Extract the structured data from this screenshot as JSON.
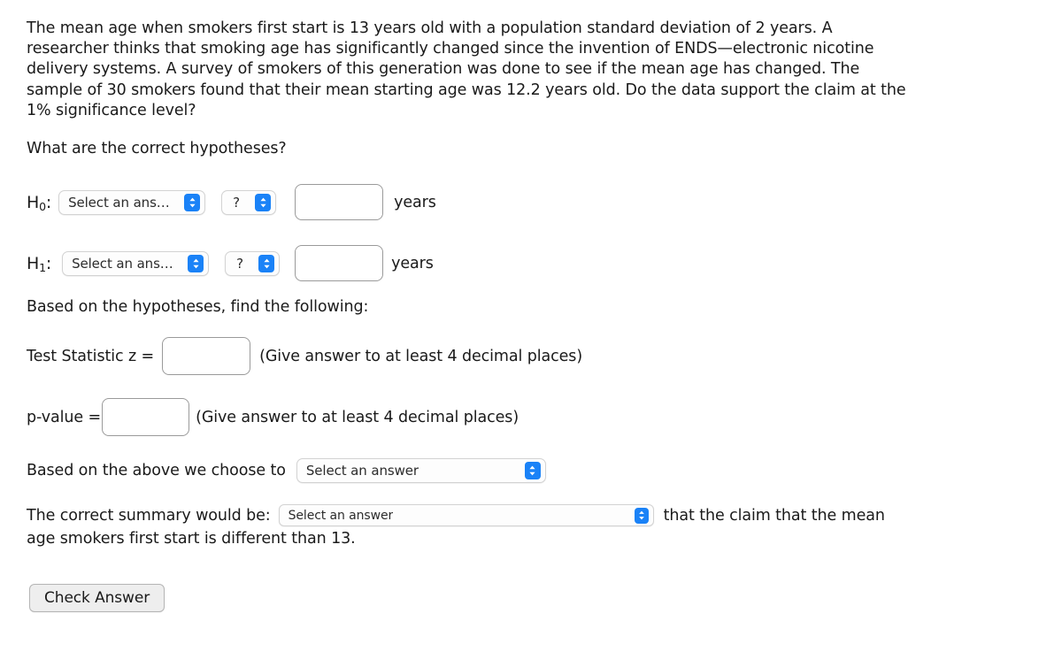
{
  "problem": {
    "statement": "The mean age when smokers first start is 13 years old with a population standard deviation of 2 years. A researcher thinks that smoking age has significantly changed since the invention of ENDS—electronic nicotine delivery systems. A survey of smokers of this generation was done to see if the mean age has changed. The sample of 30 smokers found that their mean starting age was 12.2 years old. Do the data support the claim at the 1% significance level?",
    "question": "What are the correct hypotheses?"
  },
  "hypotheses": {
    "null_label": "H",
    "null_subscript": "0",
    "alt_label": "H",
    "alt_subscript": "1",
    "colon": ":",
    "answer_placeholder": "Select an answer",
    "comparison_placeholder": "?",
    "value_input_h0": "",
    "value_input_h1": "",
    "units": "years"
  },
  "findings": {
    "heading": "Based on the hypotheses, find the following:",
    "test_statistic_label": "Test Statistic z =",
    "test_statistic_value": "",
    "test_statistic_hint": "(Give answer to at least 4 decimal places)",
    "pvalue_label": "p-value =",
    "pvalue_value": "",
    "pvalue_hint": "(Give answer to at least 4 decimal places)"
  },
  "decision": {
    "label": "Based on the above we choose to",
    "placeholder": "Select an answer"
  },
  "summary": {
    "label": "The correct summary would be:",
    "placeholder": "Select an answer",
    "trailing_line1": "that the claim that the mean",
    "trailing_line2": "age smokers first start is different than 13."
  },
  "actions": {
    "check_answer": "Check Answer"
  },
  "icons": {
    "stepper": "chevron-up-down-icon"
  },
  "colors": {
    "stepper_blue": "#1a82f7",
    "input_border": "#9a9a9a",
    "select_border": "#d3d3d3",
    "button_face": "#eeeeee",
    "text": "#1a1a1a"
  }
}
